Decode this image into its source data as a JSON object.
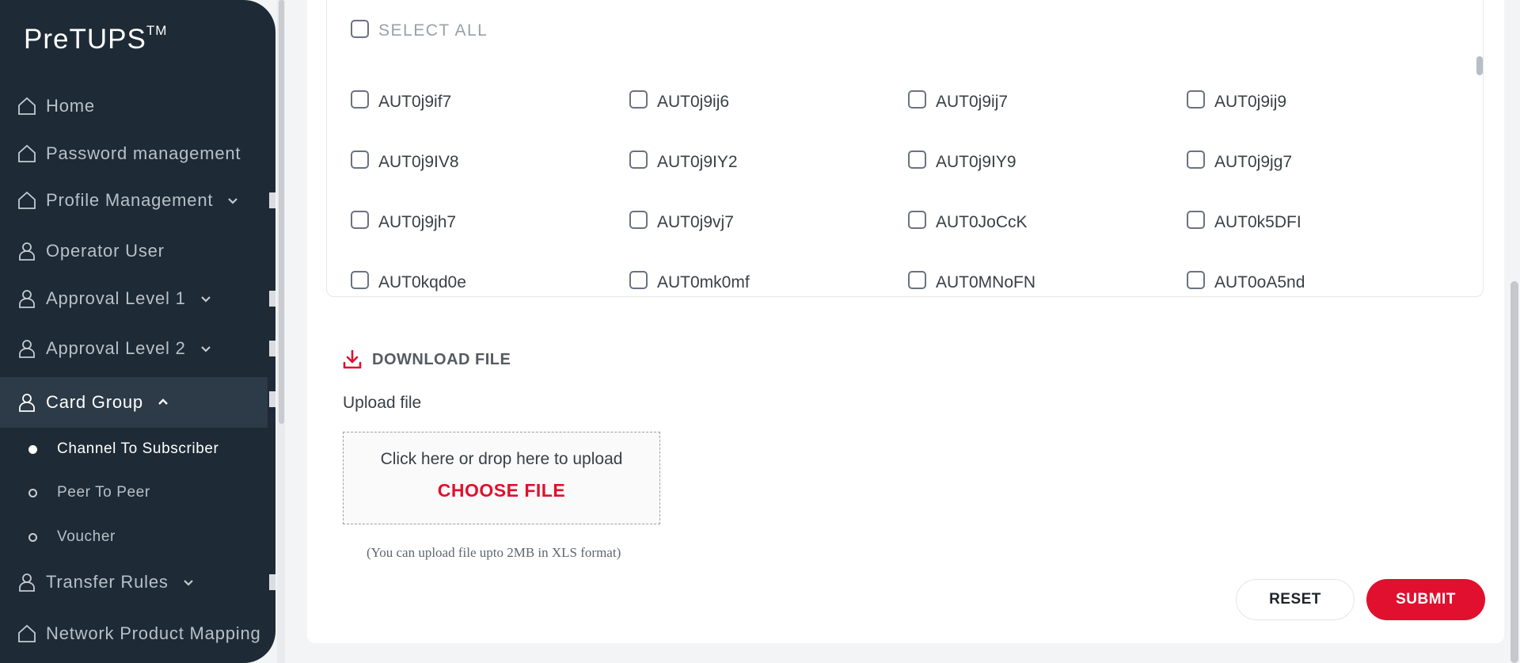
{
  "app": {
    "logo": "PreTUPS",
    "logo_tm": "TM"
  },
  "sidebar": {
    "items": [
      {
        "label": "Home",
        "icon": "home-icon"
      },
      {
        "label": "Password management",
        "icon": "home-icon"
      },
      {
        "label": "Profile Management",
        "icon": "home-icon",
        "expandable": true
      },
      {
        "label": "Operator User",
        "icon": "user-icon"
      },
      {
        "label": "Approval Level 1",
        "icon": "user-icon",
        "expandable": true
      },
      {
        "label": "Approval Level 2",
        "icon": "user-icon",
        "expandable": true
      },
      {
        "label": "Card Group",
        "icon": "user-icon",
        "expandable": true,
        "expanded": true,
        "active": true
      },
      {
        "label": "Transfer Rules",
        "icon": "user-icon",
        "expandable": true
      },
      {
        "label": "Network Product Mapping",
        "icon": "home-icon"
      }
    ],
    "card_group_sub": [
      {
        "label": "Channel To Subscriber",
        "active": true
      },
      {
        "label": "Peer To Peer",
        "active": false
      },
      {
        "label": "Voucher",
        "active": false
      }
    ]
  },
  "list": {
    "select_all_label": "SELECT ALL",
    "items": [
      "AUT0j9if7",
      "AUT0j9ij6",
      "AUT0j9ij7",
      "AUT0j9ij9",
      "AUT0j9IV8",
      "AUT0j9IY2",
      "AUT0j9IY9",
      "AUT0j9jg7",
      "AUT0j9jh7",
      "AUT0j9vj7",
      "AUT0JoCcK",
      "AUT0k5DFI",
      "AUT0kqd0e",
      "AUT0mk0mf",
      "AUT0MNoFN",
      "AUT0oA5nd"
    ]
  },
  "download": {
    "label": "DOWNLOAD FILE",
    "icon": "download-icon"
  },
  "upload": {
    "label": "Upload file",
    "hint": "Click here or drop here to upload",
    "choose": "CHOOSE FILE",
    "note": "(You can upload file upto 2MB in XLS format)"
  },
  "actions": {
    "reset": "RESET",
    "submit": "SUBMIT"
  },
  "colors": {
    "sidebar_bg": "#1e2a35",
    "accent": "#e0102e",
    "sidebar_active_bg": "#2d3a47"
  }
}
